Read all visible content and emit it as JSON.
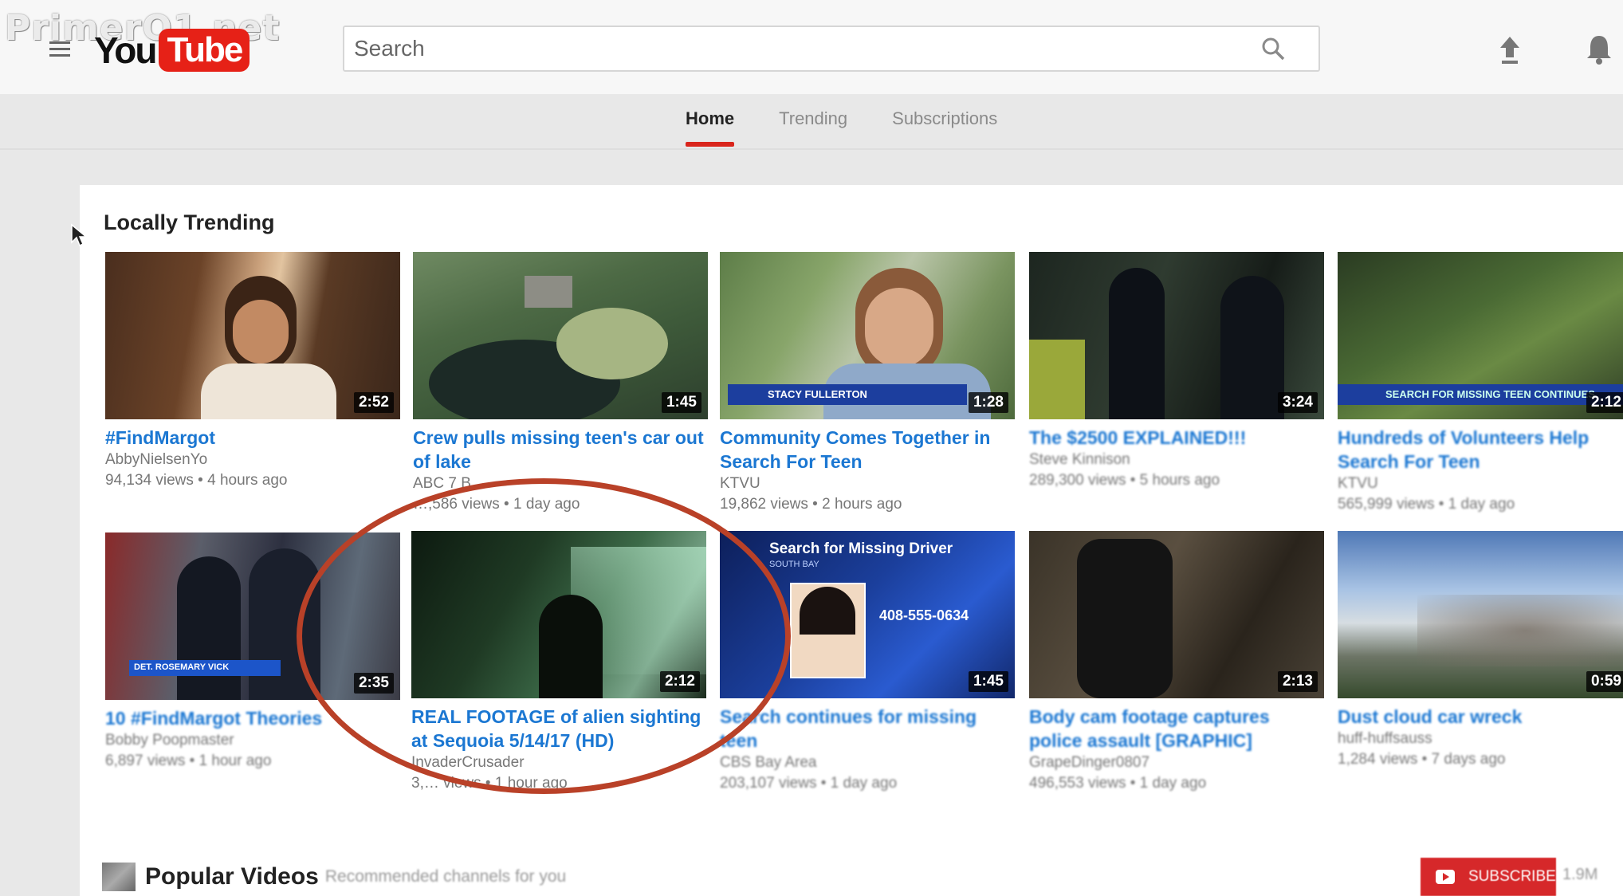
{
  "watermark": "PrimerO1.net",
  "header": {
    "logo_you": "You",
    "logo_tube": "Tube",
    "search_placeholder": "Search"
  },
  "tabs": [
    {
      "label": "Home",
      "active": true
    },
    {
      "label": "Trending",
      "active": false
    },
    {
      "label": "Subscriptions",
      "active": false
    }
  ],
  "locally_trending": {
    "title": "Locally Trending",
    "videos": [
      {
        "title": "#FindMargot",
        "channel": "AbbyNielsenYo",
        "meta": "94,134 views • 4 hours ago",
        "duration": "2:52"
      },
      {
        "title": "Crew pulls missing teen's car out of lake",
        "channel": "ABC 7 B...",
        "meta": "…,586 views • 1 day ago",
        "duration": "1:45"
      },
      {
        "title": "Community Comes Together in Search For Teen",
        "channel": "KTVU",
        "meta": "19,862 views • 2 hours ago",
        "duration": "1:28",
        "lower_third": "STACY FULLERTON"
      },
      {
        "title": "The $2500 EXPLAINED!!!",
        "channel": "Steve Kinnison",
        "meta": "289,300 views • 5 hours ago",
        "duration": "3:24"
      },
      {
        "title": "Hundreds of Volunteers Help Search For Teen",
        "channel": "KTVU",
        "meta": "565,999 views • 1 day ago",
        "duration": "2:12",
        "lower_third": "SEARCH FOR MISSING TEEN CONTINUES"
      },
      {
        "title": "10 #FindMargot Theories",
        "channel": "Bobby Poopmaster",
        "meta": "6,897 views • 1 hour ago",
        "duration": "2:35",
        "lower_third": "DET. ROSEMARY VICK"
      },
      {
        "title": "REAL FOOTAGE of alien sighting at Sequoia 5/14/17 (HD)",
        "channel": "InvaderCrusader",
        "meta": "3,… views • 1 hour ago",
        "duration": "2:12"
      },
      {
        "title": "Search continues for missing teen",
        "channel": "CBS Bay Area",
        "meta": "203,107 views • 1 day ago",
        "duration": "1:45",
        "overlay_title": "Search for Missing Driver",
        "overlay_sub": "SOUTH BAY",
        "phone": "408-555-0634"
      },
      {
        "title": "Body cam footage captures police assault [GRAPHIC]",
        "channel": "GrapeDinger0807",
        "meta": "496,553 views • 1 day ago",
        "duration": "2:13"
      },
      {
        "title": "Dust cloud car wreck",
        "channel": "huff-huffsauss",
        "meta": "1,284 views • 7 days ago",
        "duration": "0:59"
      }
    ]
  },
  "popular": {
    "title": "Popular Videos",
    "subtitle": "Recommended channels for you",
    "subscribe_label": "SUBSCRIBE",
    "count": "1.9M"
  },
  "colors": {
    "brand_red": "#e62117",
    "link_blue": "#1b77d2",
    "circle": "#b94128"
  }
}
